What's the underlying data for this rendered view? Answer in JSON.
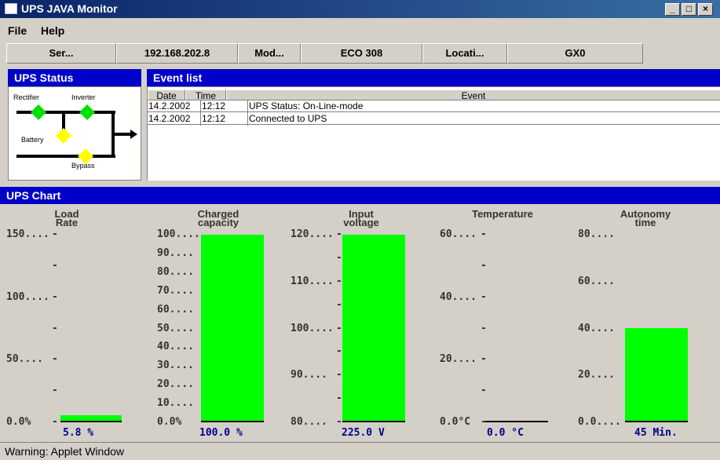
{
  "window": {
    "title": "UPS JAVA Monitor",
    "minimize": "_",
    "maximize": "□",
    "close": "×"
  },
  "menu": [
    "File",
    "Help"
  ],
  "info": [
    {
      "label": "Ser...",
      "value": "192.168.202.8"
    },
    {
      "label": "Mod...",
      "value": "ECO 308"
    },
    {
      "label": "Locati...",
      "value": "GX0"
    }
  ],
  "status_panel": {
    "title": "UPS Status",
    "labels": {
      "rectifier": "Rectifier",
      "inverter": "Inverter",
      "battery": "Battery",
      "bypass": "Bypass"
    },
    "colors": {
      "active": "#00e000",
      "standby": "#ffff00"
    }
  },
  "events": {
    "title": "Event list",
    "columns": [
      "Date",
      "Time",
      "Event"
    ],
    "rows": [
      {
        "date": "14.2.2002",
        "time": "12:12",
        "event": "UPS Status: On-Line-mode"
      },
      {
        "date": "14.2.2002",
        "time": "12:12",
        "event": "Connected to UPS"
      }
    ]
  },
  "chart_panel": {
    "title": "UPS Chart"
  },
  "chart_data": [
    {
      "type": "bar",
      "title": "Load Rate",
      "ticks": [
        "150....",
        "100....",
        "50....",
        "0.0%"
      ],
      "ylim": [
        0,
        150
      ],
      "value": 5.8,
      "value_label": "5.8 %"
    },
    {
      "type": "bar",
      "title": "Charged capacity",
      "ticks": [
        "100....",
        "90....",
        "80....",
        "70....",
        "60....",
        "50....",
        "40....",
        "30....",
        "20....",
        "10....",
        "0.0%"
      ],
      "ylim": [
        0,
        100
      ],
      "value": 100,
      "value_label": "100.0 %"
    },
    {
      "type": "bar",
      "title": "Input voltage",
      "ticks": [
        "120....",
        "110....",
        "100....",
        "90....",
        "80...."
      ],
      "ylim": [
        80,
        120
      ],
      "value": 225,
      "value_label": "225.0 V"
    },
    {
      "type": "bar",
      "title": "Temperature",
      "ticks": [
        "60....",
        "40....",
        "20....",
        "0.0°C"
      ],
      "ylim": [
        0,
        60
      ],
      "value": 0,
      "value_label": "0.0 °C"
    },
    {
      "type": "bar",
      "title": "Autonomy time",
      "ticks": [
        "80....",
        "60....",
        "40....",
        "20....",
        "0.0...."
      ],
      "ylim": [
        0,
        90
      ],
      "value": 45,
      "value_label": "45 Min."
    }
  ],
  "status_bar": {
    "text": "Warning: Applet Window"
  }
}
